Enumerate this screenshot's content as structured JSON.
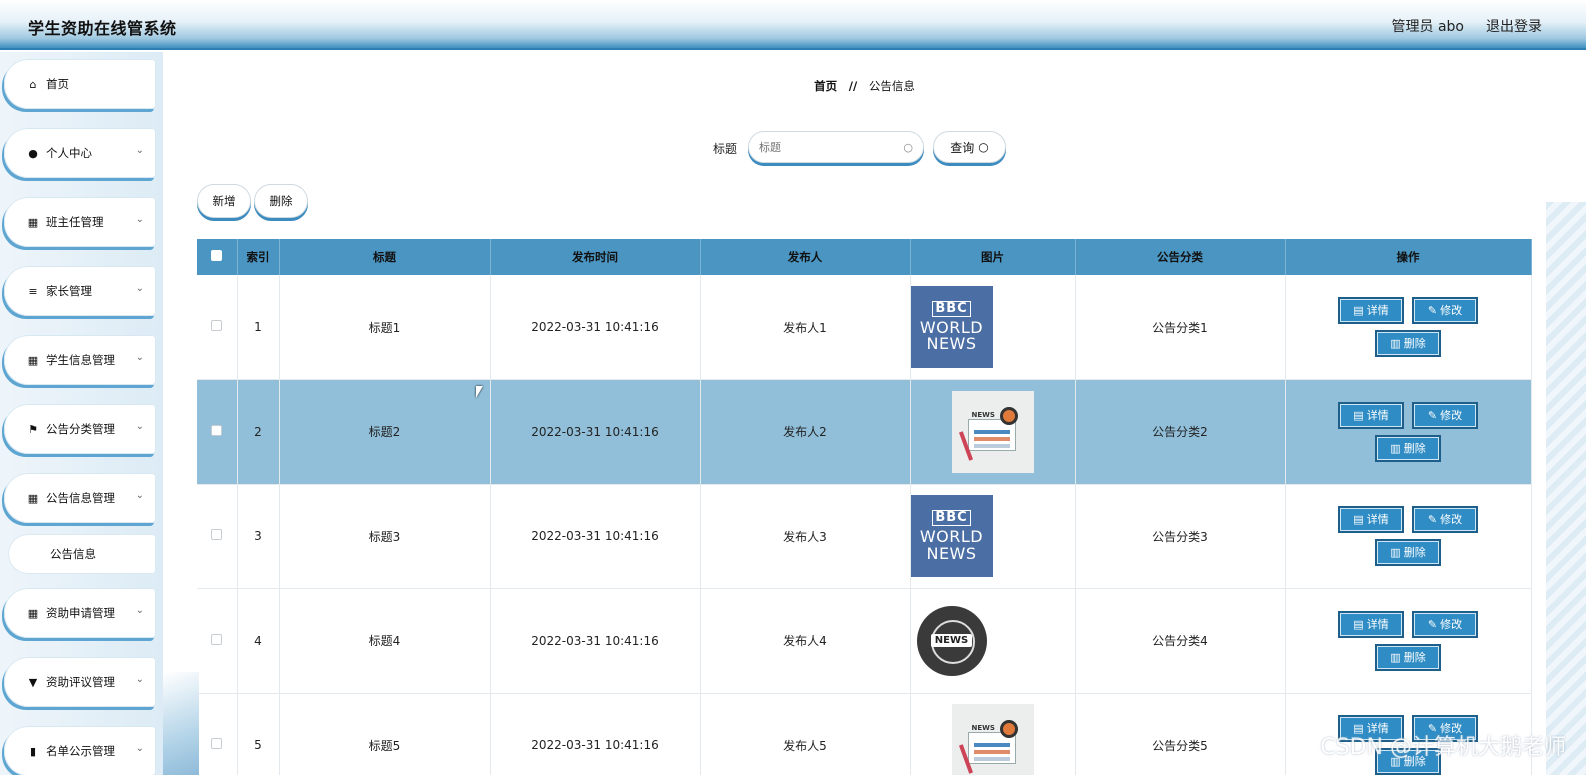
{
  "app": {
    "title": "学生资助在线管系统"
  },
  "header": {
    "user_label": "管理员 abo",
    "logout_label": "退出登录"
  },
  "sidebar": {
    "items": [
      {
        "label": "首页",
        "icon": "home-icon",
        "glyph": "⌂"
      },
      {
        "label": "个人中心",
        "icon": "person-icon",
        "glyph": "●"
      },
      {
        "label": "班主任管理",
        "icon": "grid-icon",
        "glyph": "▦"
      },
      {
        "label": "家长管理",
        "icon": "list-icon",
        "glyph": "≡"
      },
      {
        "label": "学生信息管理",
        "icon": "grid-icon",
        "glyph": "▦"
      },
      {
        "label": "公告分类管理",
        "icon": "flag-icon",
        "glyph": "⚑"
      },
      {
        "label": "公告信息管理",
        "icon": "grid-icon",
        "glyph": "▦"
      },
      {
        "label": "资助申请管理",
        "icon": "grid-icon",
        "glyph": "▦"
      },
      {
        "label": "资助评议管理",
        "icon": "pin-icon",
        "glyph": "▼"
      },
      {
        "label": "名单公示管理",
        "icon": "briefcase-icon",
        "glyph": "▮"
      }
    ],
    "sub_item": "公告信息"
  },
  "breadcrumb": {
    "home": "首页",
    "separator": "//",
    "current": "公告信息"
  },
  "search": {
    "label": "标题",
    "placeholder": "标题",
    "button": "查询"
  },
  "actions": {
    "add": "新增",
    "delete": "删除"
  },
  "table": {
    "columns": [
      "索引",
      "标题",
      "发布时间",
      "发布人",
      "图片",
      "公告分类",
      "操作"
    ],
    "rows": [
      {
        "index": "1",
        "title": "标题1",
        "time": "2022-03-31 10:41:16",
        "publisher": "发布人1",
        "image": "bbc",
        "category": "公告分类1"
      },
      {
        "index": "2",
        "title": "标题2",
        "time": "2022-03-31 10:41:16",
        "publisher": "发布人2",
        "image": "paper",
        "category": "公告分类2"
      },
      {
        "index": "3",
        "title": "标题3",
        "time": "2022-03-31 10:41:16",
        "publisher": "发布人3",
        "image": "bbc",
        "category": "公告分类3"
      },
      {
        "index": "4",
        "title": "标题4",
        "time": "2022-03-31 10:41:16",
        "publisher": "发布人4",
        "image": "globe",
        "category": "公告分类4"
      },
      {
        "index": "5",
        "title": "标题5",
        "time": "2022-03-31 10:41:16",
        "publisher": "发布人5",
        "image": "paper",
        "category": "公告分类5"
      }
    ],
    "ops": {
      "detail": "详情",
      "edit": "修改",
      "delete": "删除"
    }
  },
  "images": {
    "bbc_line1": "BBC",
    "bbc_line2": "WORLD",
    "bbc_line3": "NEWS",
    "news_badge": "NEWS"
  },
  "watermark": "CSDN @计算机大鹅老师",
  "colors": {
    "accent": "#4a95c2",
    "button": "#2f8cc4",
    "highlight_row": "#91bfd9"
  }
}
